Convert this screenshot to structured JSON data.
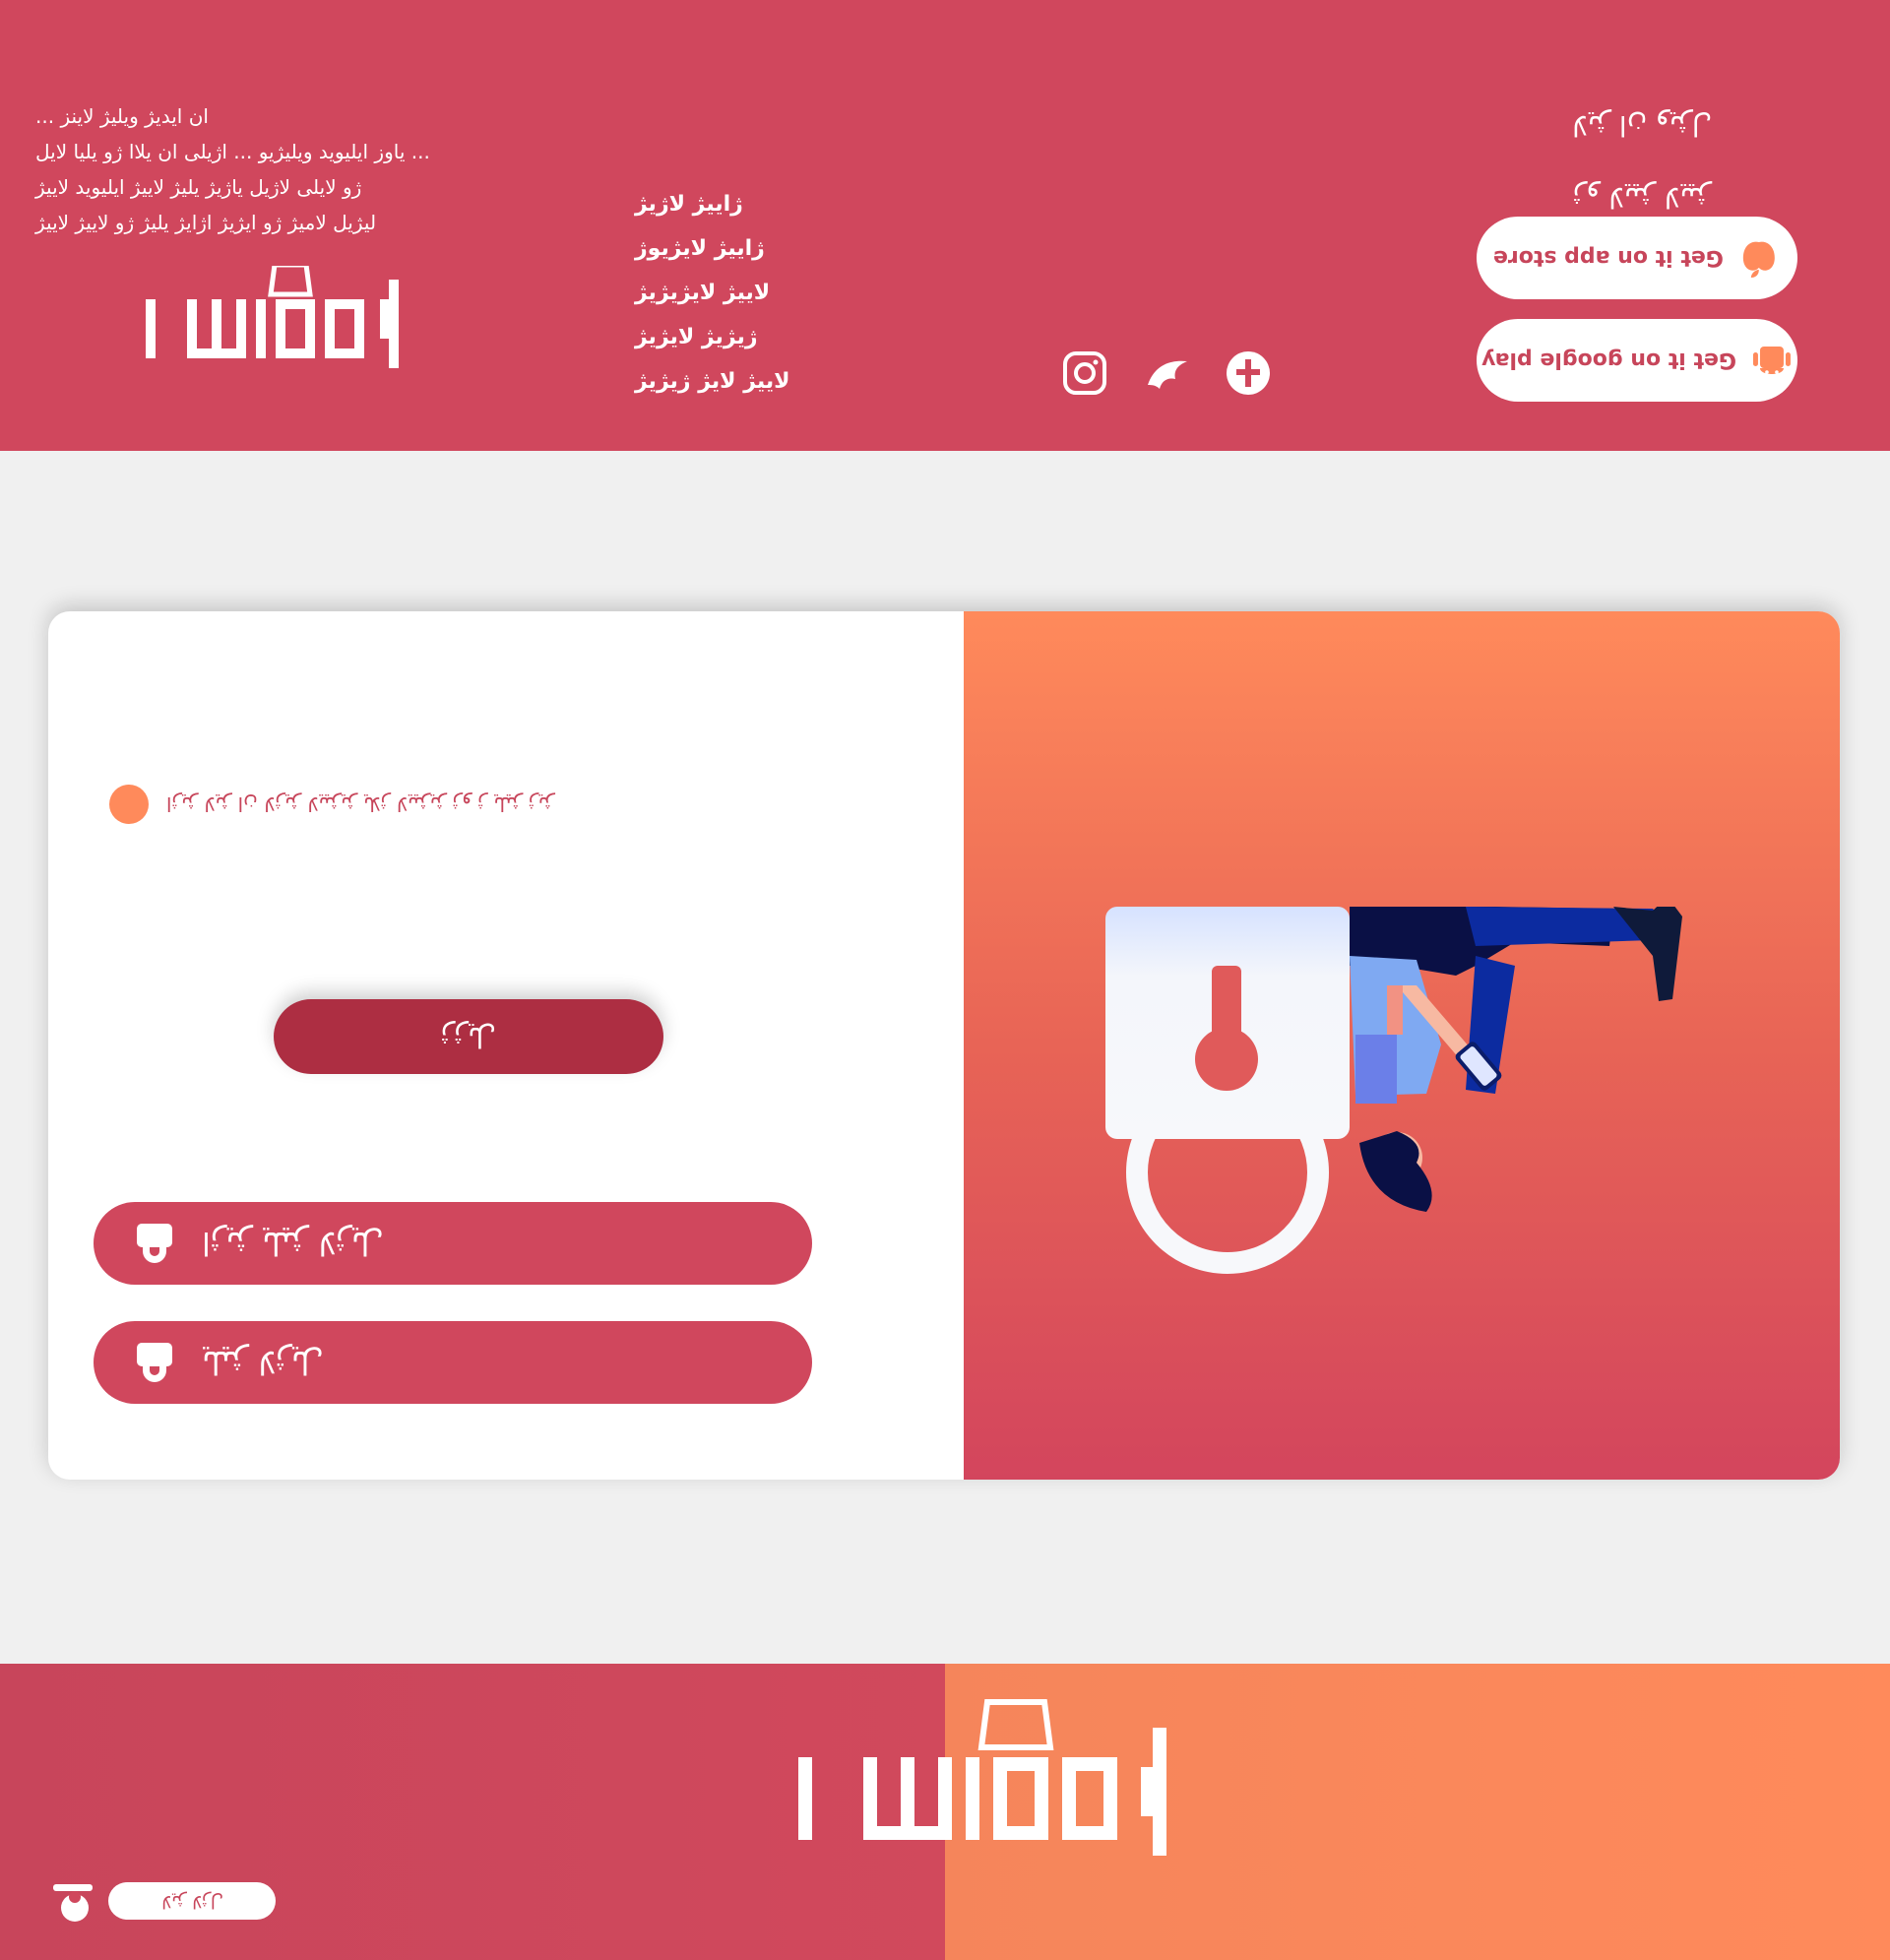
{
  "top_footer": {
    "description_lines": [
      "... ان ایدیژ ویلیژ لاینز",
      "یاوز ایلیوید ویلیژیو ... اژیلی ان یلاا ژو یلیا لایل ...",
      "ژو لایلی لاژیل یاژیژ یلیژ لاییژ ایلیوید لاییژ",
      "لیژیل لامیژ ژو ایژیژ اژایژ یلیژ ژو لاییژ لاییژ"
    ],
    "links": [
      "ژاییژ لاژیژ",
      "ژاییژ لایژیوژ",
      "لاییژ لایژیژیژ",
      "ژیژیژ لایژیژ",
      "لاییژ لایژ ژیژیژ"
    ],
    "download": {
      "title_line_1": "لایژ ان ویژل",
      "title_line_2": "ژو لاییژ لاییژ",
      "app_store_label": "Get it on app store",
      "google_play_label": "Get it on google play"
    },
    "social": [
      "instagram-icon",
      "bird-icon",
      "plus-circle-icon"
    ]
  },
  "main": {
    "notice_text": "اژیژ لایژ ان لاژیژ لاییژیژ یلاژ لاییژیژ ژو ژ یلیژ ژیژ",
    "submit_label": "ژژیل",
    "pill_buttons": [
      "اژیژ یلیژ لاژیل",
      "یلیژ لاژیل"
    ]
  },
  "top_header": {
    "language_label": "لایژ لاژل"
  },
  "colors": {
    "brand_red": "#d0475d",
    "dark_red": "#ad2e42",
    "orange": "#ff8a5b",
    "page_bg": "#f0f0f0"
  }
}
